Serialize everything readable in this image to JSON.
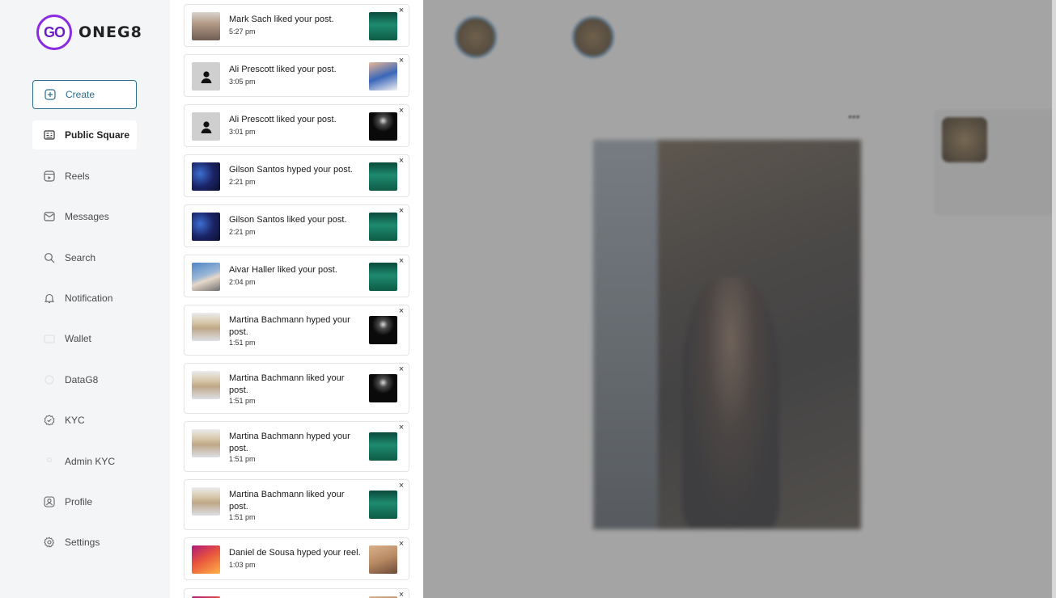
{
  "brand": {
    "logo_mark": "GO",
    "name": "ONEG8"
  },
  "sidebar": {
    "items": [
      {
        "label": "Create",
        "icon": "plus-square-icon"
      },
      {
        "label": "Public Square",
        "icon": "feed-icon"
      },
      {
        "label": "Reels",
        "icon": "reels-icon"
      },
      {
        "label": "Messages",
        "icon": "message-icon"
      },
      {
        "label": "Search",
        "icon": "search-icon"
      },
      {
        "label": "Notification",
        "icon": "bell-icon"
      },
      {
        "label": "Wallet",
        "icon": "wallet-icon"
      },
      {
        "label": "DataG8",
        "icon": "data-icon"
      },
      {
        "label": "KYC",
        "icon": "verified-badge-icon"
      },
      {
        "label": "Admin KYC",
        "icon": "admin-icon"
      },
      {
        "label": "Profile",
        "icon": "user-icon"
      },
      {
        "label": "Settings",
        "icon": "gear-icon"
      }
    ],
    "active": "Public Square"
  },
  "notifications": [
    {
      "text": "Mark Sach liked your post.",
      "time": "5:27 pm",
      "avatar": "photo-mark",
      "thumb": "forest"
    },
    {
      "text": "Ali Prescott liked your post.",
      "time": "3:05 pm",
      "avatar": "generic",
      "thumb": "woman"
    },
    {
      "text": "Ali Prescott liked your post.",
      "time": "3:01 pm",
      "avatar": "generic",
      "thumb": "dark"
    },
    {
      "text": "Gilson Santos hyped your post.",
      "time": "2:21 pm",
      "avatar": "photo-gilson",
      "thumb": "forest"
    },
    {
      "text": "Gilson Santos liked your post.",
      "time": "2:21 pm",
      "avatar": "photo-gilson",
      "thumb": "forest"
    },
    {
      "text": "Aivar Haller liked your post.",
      "time": "2:04 pm",
      "avatar": "photo-aivar",
      "thumb": "forest"
    },
    {
      "text": "Martina Bachmann hyped your post.",
      "time": "1:51 pm",
      "avatar": "photo-martina",
      "thumb": "dark"
    },
    {
      "text": "Martina Bachmann liked your post.",
      "time": "1:51 pm",
      "avatar": "photo-martina",
      "thumb": "dark"
    },
    {
      "text": "Martina Bachmann hyped your post.",
      "time": "1:51 pm",
      "avatar": "photo-martina",
      "thumb": "forest"
    },
    {
      "text": "Martina Bachmann liked your post.",
      "time": "1:51 pm",
      "avatar": "photo-martina",
      "thumb": "forest"
    },
    {
      "text": "Daniel de Sousa hyped your reel.",
      "time": "1:03 pm",
      "avatar": "photo-daniel",
      "thumb": "reel"
    }
  ],
  "close_glyph": "×"
}
